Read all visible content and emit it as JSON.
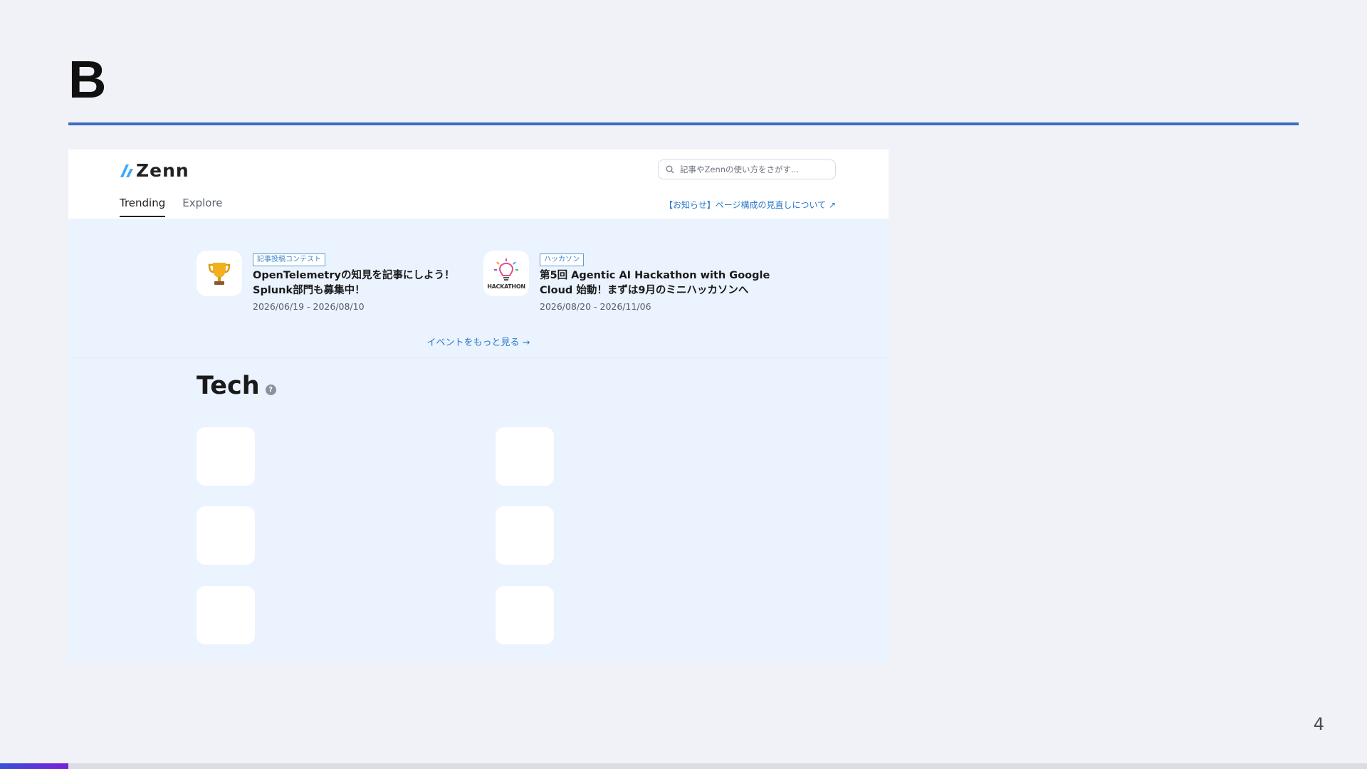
{
  "slide": {
    "title": "B",
    "page_number": "4",
    "progress_fraction": 0.05
  },
  "zenn": {
    "logo_text": "Zenn",
    "search_placeholder": "記事やZennの使い方をさがす...",
    "nav_tabs": [
      {
        "label": "Trending",
        "active": true
      },
      {
        "label": "Explore",
        "active": false
      }
    ],
    "notice_link": "【お知らせ】ページ構成の見直しについて ↗",
    "events": [
      {
        "icon": "trophy-icon",
        "tag": "記事投稿コンテスト",
        "title_line1": "OpenTelemetryの知見を記事にしよう！",
        "title_line2": "Splunk部門も募集中！",
        "date": "2026/06/19 - 2026/08/10"
      },
      {
        "icon": "lightbulb-icon",
        "icon_caption": "HACKATHON",
        "tag": "ハッカソン",
        "title_line1": "第5回 Agentic AI Hackathon with Google",
        "title_line2": "Cloud 始動！まずは9月のミニハッカソンへ",
        "date": "2026/08/20 - 2026/11/06"
      }
    ],
    "more_events": "イベントをもっと見る →",
    "tech_title": "Tech",
    "help_icon_glyph": "?"
  },
  "colors": {
    "accent_rule": "#3c6cc4",
    "page_bg": "#f0f2f7",
    "screenshot_bg": "#eaf3fe",
    "link": "#2b78c9"
  }
}
